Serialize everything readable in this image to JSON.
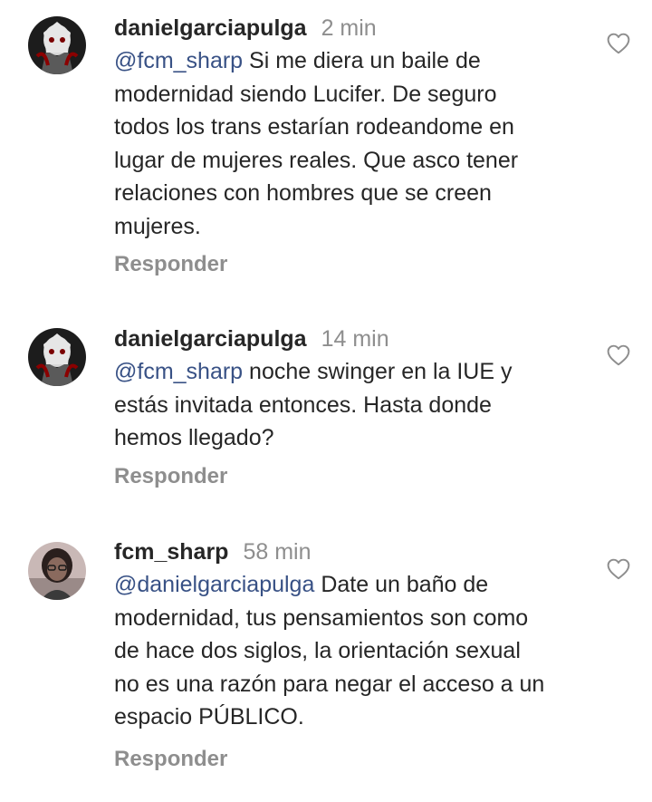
{
  "comments": [
    {
      "username": "danielgarciapulga",
      "time": "2 min",
      "mention": "@fcm_sharp",
      "lines": [
        " Si me diera un baile de",
        "modernidad siendo Lucifer.  De seguro",
        "todos los trans estarían rodeandome en",
        "lugar de mujeres reales.  Que asco tener",
        "relaciones con hombres que se creen",
        "mujeres."
      ],
      "reply_label": "Responder",
      "like_icon": "heart-outline-icon"
    },
    {
      "username": "danielgarciapulga",
      "time": "14 min",
      "mention": "@fcm_sharp",
      "lines": [
        " noche swinger en la IUE y",
        "estás invitada entonces.  Hasta donde",
        "hemos llegado?"
      ],
      "reply_label": "Responder",
      "like_icon": "heart-outline-icon"
    },
    {
      "username": "fcm_sharp",
      "time": "58 min",
      "mention": "@danielgarciapulga",
      "lines": [
        " Date un baño de",
        "modernidad, tus pensamientos son como",
        "de hace dos siglos, la orientación sexual",
        "no es una razón para negar el acceso a un",
        "espacio PÚBLICO."
      ],
      "reply_label": "Responder",
      "like_icon": "heart-outline-icon"
    }
  ],
  "colors": {
    "text": "#262626",
    "muted": "#8e8e8e",
    "mention": "#385185"
  }
}
